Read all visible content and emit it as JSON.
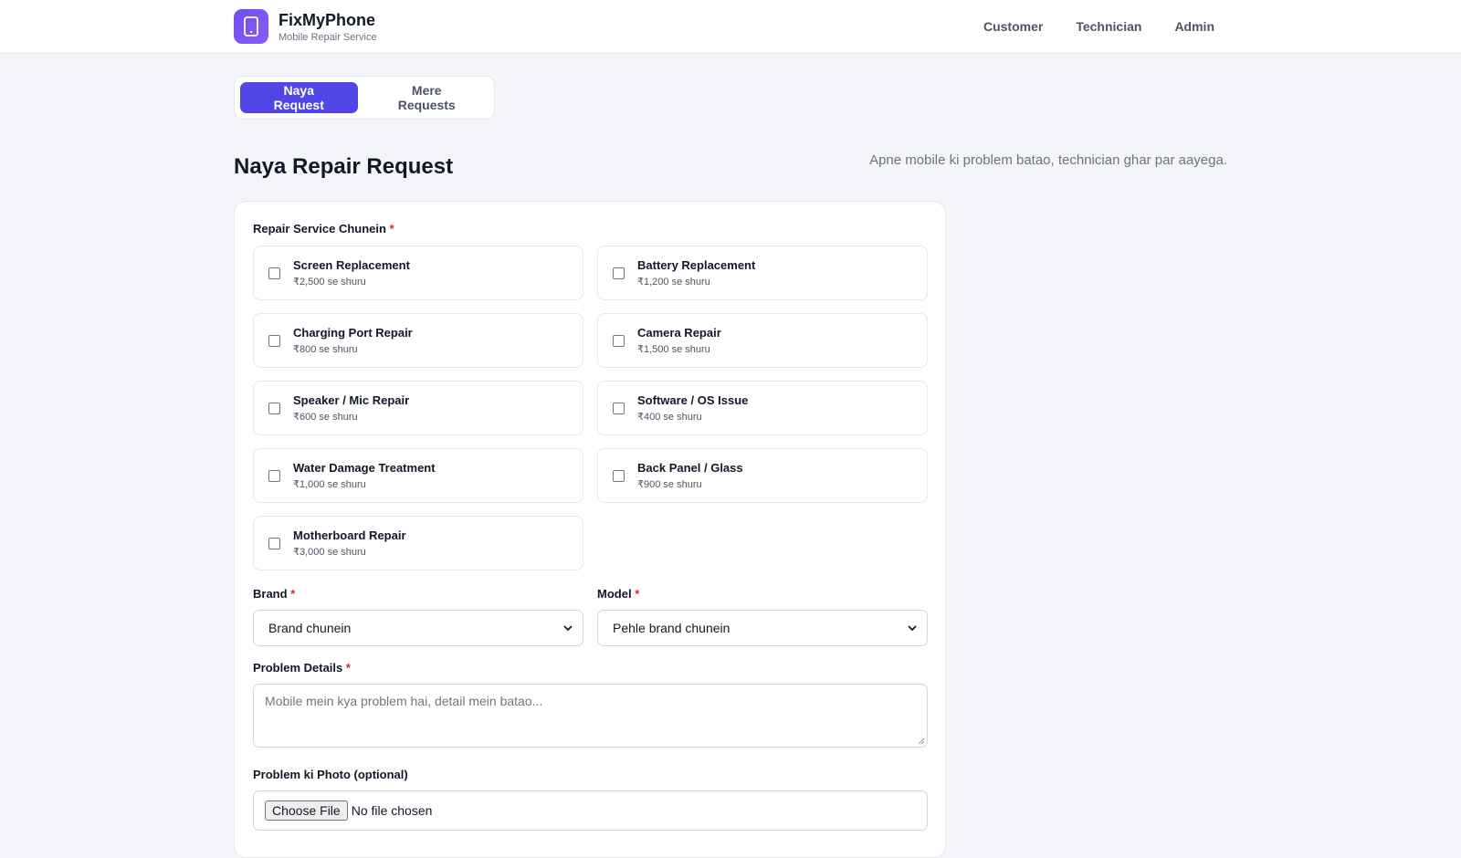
{
  "app": {
    "name": "FixMyPhone",
    "tagline": "Mobile Repair Service",
    "brand_color": "#4f46e5",
    "logo_icon": "phone-icon"
  },
  "nav": {
    "items": [
      "Customer",
      "Technician",
      "Admin"
    ]
  },
  "tabs": [
    {
      "label": "Naya Request",
      "active": true
    },
    {
      "label": "Mere Requests",
      "active": false
    }
  ],
  "page": {
    "title": "Naya Repair Request",
    "subtitle": "Apne mobile ki problem batao, technician ghar par aayega."
  },
  "form": {
    "services_label": "Repair Service Chunein",
    "required_mark": "*",
    "services": [
      {
        "name": "Screen Replacement",
        "price": "₹2,500 se shuru",
        "checked": false
      },
      {
        "name": "Battery Replacement",
        "price": "₹1,200 se shuru",
        "checked": false
      },
      {
        "name": "Charging Port Repair",
        "price": "₹800 se shuru",
        "checked": false
      },
      {
        "name": "Camera Repair",
        "price": "₹1,500 se shuru",
        "checked": false
      },
      {
        "name": "Speaker / Mic Repair",
        "price": "₹600 se shuru",
        "checked": false
      },
      {
        "name": "Software / OS Issue",
        "price": "₹400 se shuru",
        "checked": false
      },
      {
        "name": "Water Damage Treatment",
        "price": "₹1,000 se shuru",
        "checked": false
      },
      {
        "name": "Back Panel / Glass",
        "price": "₹900 se shuru",
        "checked": false
      },
      {
        "name": "Motherboard Repair",
        "price": "₹3,000 se shuru",
        "checked": false
      }
    ],
    "brand_label": "Brand",
    "brand_value": "Brand chunein",
    "model_label": "Model",
    "model_value": "Pehle brand chunein",
    "problem_label": "Problem Details",
    "problem_placeholder": "Mobile mein kya problem hai, detail mein batao...",
    "photo_label": "Problem ki Photo (optional)",
    "file_button": "Choose File",
    "file_status": "No file chosen"
  }
}
